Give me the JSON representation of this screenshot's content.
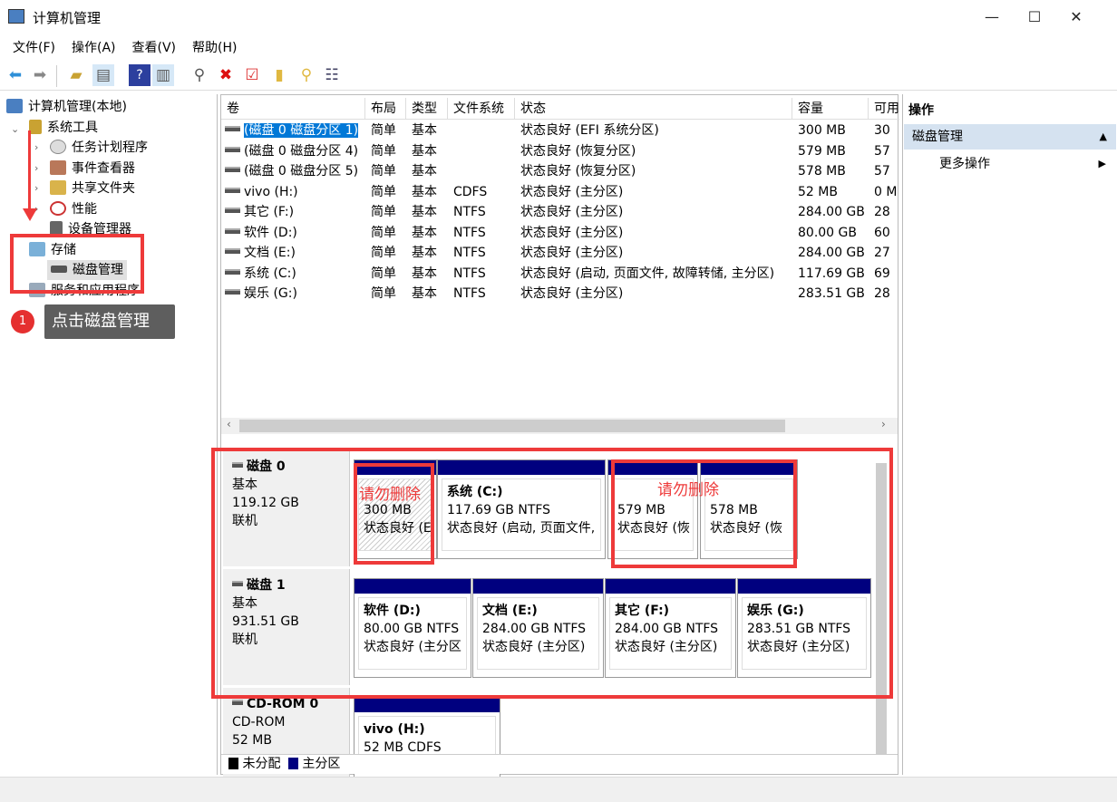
{
  "window": {
    "title": "计算机管理",
    "minimize": "—",
    "maximize": "☐",
    "close": "✕"
  },
  "menu": [
    "文件(F)",
    "操作(A)",
    "查看(V)",
    "帮助(H)"
  ],
  "toolbar": {
    "back": "back-icon",
    "forward": "forward-icon",
    "up": "folder-up-icon",
    "show_hide": "console-tree-icon",
    "help": "help-icon",
    "pane": "action-pane-icon",
    "connect": "connect-icon",
    "delete": "delete-icon",
    "properties": "properties-icon",
    "import": "import-icon",
    "search": "search-icon",
    "list": "list-icon"
  },
  "tree": {
    "root": "计算机管理(本地)",
    "system_tools": "系统工具",
    "task_scheduler": "任务计划程序",
    "event_viewer": "事件查看器",
    "shared_folders": "共享文件夹",
    "performance": "性能",
    "device_manager": "设备管理器",
    "storage": "存储",
    "disk_management": "磁盘管理",
    "services": "服务和应用程序"
  },
  "annotation": {
    "step": "1",
    "text": "点击磁盘管理",
    "warn1": "请勿删除",
    "warn2": "请勿删除",
    "color": "#ee3a3a"
  },
  "table": {
    "columns": [
      "卷",
      "布局",
      "类型",
      "文件系统",
      "状态",
      "容量",
      "可用"
    ],
    "rows": [
      [
        "(磁盘 0 磁盘分区 1)",
        "简单",
        "基本",
        "",
        "状态良好 (EFI 系统分区)",
        "300 MB",
        "30"
      ],
      [
        "(磁盘 0 磁盘分区 4)",
        "简单",
        "基本",
        "",
        "状态良好 (恢复分区)",
        "579 MB",
        "57"
      ],
      [
        "(磁盘 0 磁盘分区 5)",
        "简单",
        "基本",
        "",
        "状态良好 (恢复分区)",
        "578 MB",
        "57"
      ],
      [
        "vivo (H:)",
        "简单",
        "基本",
        "CDFS",
        "状态良好 (主分区)",
        "52 MB",
        "0 M"
      ],
      [
        "其它 (F:)",
        "简单",
        "基本",
        "NTFS",
        "状态良好 (主分区)",
        "284.00 GB",
        "28"
      ],
      [
        "软件 (D:)",
        "简单",
        "基本",
        "NTFS",
        "状态良好 (主分区)",
        "80.00 GB",
        "60"
      ],
      [
        "文档 (E:)",
        "简单",
        "基本",
        "NTFS",
        "状态良好 (主分区)",
        "284.00 GB",
        "27"
      ],
      [
        "系统 (C:)",
        "简单",
        "基本",
        "NTFS",
        "状态良好 (启动, 页面文件, 故障转储, 主分区)",
        "117.69 GB",
        "69"
      ],
      [
        "娱乐 (G:)",
        "简单",
        "基本",
        "NTFS",
        "状态良好 (主分区)",
        "283.51 GB",
        "28"
      ]
    ]
  },
  "disks": [
    {
      "name": "磁盘 0",
      "type": "基本",
      "size": "119.12 GB",
      "status": "联机",
      "parts": [
        {
          "name": "",
          "size": "300 MB",
          "status": "状态良好 (EFI"
        },
        {
          "name": "系统 (C:)",
          "size": "117.69 GB NTFS",
          "status": "状态良好 (启动, 页面文件,"
        },
        {
          "name": "",
          "size": "579 MB",
          "status": "状态良好 (恢"
        },
        {
          "name": "",
          "size": "578 MB",
          "status": "状态良好 (恢"
        }
      ]
    },
    {
      "name": "磁盘 1",
      "type": "基本",
      "size": "931.51 GB",
      "status": "联机",
      "parts": [
        {
          "name": "软件 (D:)",
          "size": "80.00 GB NTFS",
          "status": "状态良好 (主分区"
        },
        {
          "name": "文档 (E:)",
          "size": "284.00 GB NTFS",
          "status": "状态良好 (主分区)"
        },
        {
          "name": "其它 (F:)",
          "size": "284.00 GB NTFS",
          "status": "状态良好 (主分区)"
        },
        {
          "name": "娱乐 (G:)",
          "size": "283.51 GB NTFS",
          "status": "状态良好 (主分区)"
        }
      ]
    },
    {
      "name": "CD-ROM 0",
      "type": "CD-ROM",
      "size": "52 MB",
      "status": "",
      "parts": [
        {
          "name": "vivo (H:)",
          "size": "52 MB CDFS",
          "status": ""
        }
      ]
    }
  ],
  "legend": {
    "unallocated": "未分配",
    "primary": "主分区",
    "primary_color": "#00007f"
  },
  "actions": {
    "title": "操作",
    "section": "磁盘管理",
    "more": "更多操作"
  }
}
